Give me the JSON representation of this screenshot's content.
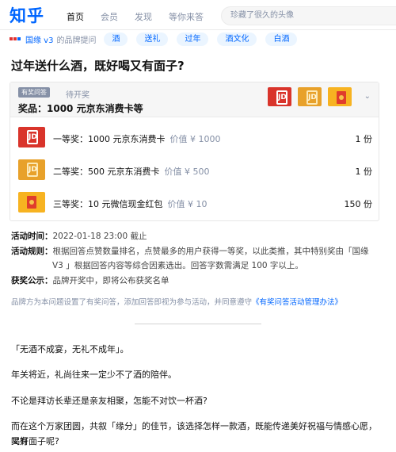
{
  "header": {
    "logo": "知乎",
    "nav": [
      "首页",
      "会员",
      "发现",
      "等你来答"
    ],
    "search_placeholder": "珍藏了很久的头像"
  },
  "topic_row": {
    "brand": "国缘 v3",
    "brand_suffix": "的品牌提问",
    "tags": [
      "酒",
      "送礼",
      "过年",
      "酒文化",
      "白酒"
    ]
  },
  "question": {
    "title": "过年送什么酒，既好喝又有面子?"
  },
  "prize_card": {
    "badge": "有奖问答",
    "status": "待开奖",
    "headline": "奖品：1000 元京东消费卡等",
    "chevron": "⌄",
    "tiers": [
      {
        "name": "一等奖：1000 元京东消费卡",
        "worth": "价值 ¥ 1000",
        "count": "1 份",
        "image": "jd-red"
      },
      {
        "name": "二等奖：500 元京东消费卡",
        "worth": "价值 ¥ 500",
        "count": "1 份",
        "image": "jd-gold"
      },
      {
        "name": "三等奖：10 元微信现金红包",
        "worth": "价值 ¥ 10",
        "count": "150 份",
        "image": "wechat-red-packet"
      }
    ]
  },
  "activity": {
    "time_label": "活动时间：",
    "time_value": "2022-01-18 23:00 截止",
    "rules_label": "活动规则：",
    "rules_value_1": "根据回答点赞数量排名，点赞最多的用户获得一等奖，以此类推，其中特别奖由「国缘",
    "rules_value_2": "V3 」根据回答内容等综合因素选出。回答字数需满足 100 字以上。",
    "winners_label": "获奖公示：",
    "winners_value": "品牌开奖中，即将公布获奖名单",
    "note_prefix": "品牌方为本问题设置了有奖问答，添加回答即视为参与活动，并同意遵守",
    "note_link": "《有奖问答活动管理办法》"
  },
  "answer": {
    "p1": "「无酒不成宴，无礼不成年」。",
    "p2": "年关将近，礼尚往来一定少不了酒的陪伴。",
    "p3": "不论是拜访长辈还是亲友相聚，怎能不对饮一杯酒?",
    "p4_line1": "而在这个万家团圆，共叙「缘分」的佳节，该选择怎样一款酒，既能传递美好祝福与情感心愿，又好",
    "p4_line2": "喝有面子呢?"
  }
}
